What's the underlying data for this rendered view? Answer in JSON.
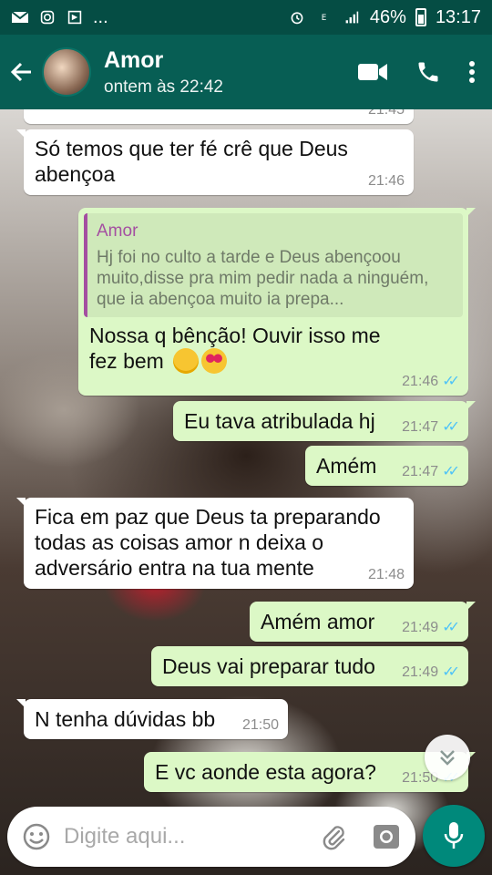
{
  "status_bar": {
    "battery": "46%",
    "time": "13:17",
    "left_icons": [
      "mail-icon",
      "instagram-icon",
      "app-icon",
      "more-dots"
    ],
    "more": "..."
  },
  "header": {
    "contact_name": "Amor",
    "last_seen": "ontem às 22:42",
    "actions": [
      "video-call-icon",
      "phone-icon",
      "menu-icon"
    ]
  },
  "messages": [
    {
      "dir": "in",
      "text": "Só temos que ter fé crê que Deus abençoa",
      "time": "21:46"
    },
    {
      "dir": "out",
      "quote_author": "Amor",
      "quote_text": "Hj foi no culto a tarde e Deus abençoou muito,disse pra mim pedir nada a ninguém, que ia abençoa muito ia prepa...",
      "text": "Nossa q bênção! Ouvir isso me fez bem",
      "time": "21:46",
      "read": true
    },
    {
      "dir": "out",
      "text": "Eu tava atribulada hj",
      "time": "21:47",
      "read": true
    },
    {
      "dir": "out",
      "text": "Amém",
      "time": "21:47",
      "read": true
    },
    {
      "dir": "in",
      "text": "Fica em paz que Deus ta preparando todas as coisas amor n deixa o adversário entra na tua mente",
      "time": "21:48"
    },
    {
      "dir": "out",
      "text": "Amém amor",
      "time": "21:49",
      "read": true
    },
    {
      "dir": "out",
      "text": "Deus vai preparar tudo",
      "time": "21:49",
      "read": true
    },
    {
      "dir": "in",
      "text": "N tenha dúvidas bb",
      "time": "21:50"
    },
    {
      "dir": "out",
      "text": "E vc aonde esta agora?",
      "time": "21:50",
      "read": true
    }
  ],
  "partial_top": {
    "time": "21:45"
  },
  "input": {
    "placeholder": "Digite aqui..."
  },
  "colors": {
    "header": "#075e54",
    "status_bar": "#054d44",
    "outgoing": "#dcf8c6",
    "incoming": "#ffffff",
    "accent": "#00897b",
    "read_ticks": "#4fc3f7"
  }
}
